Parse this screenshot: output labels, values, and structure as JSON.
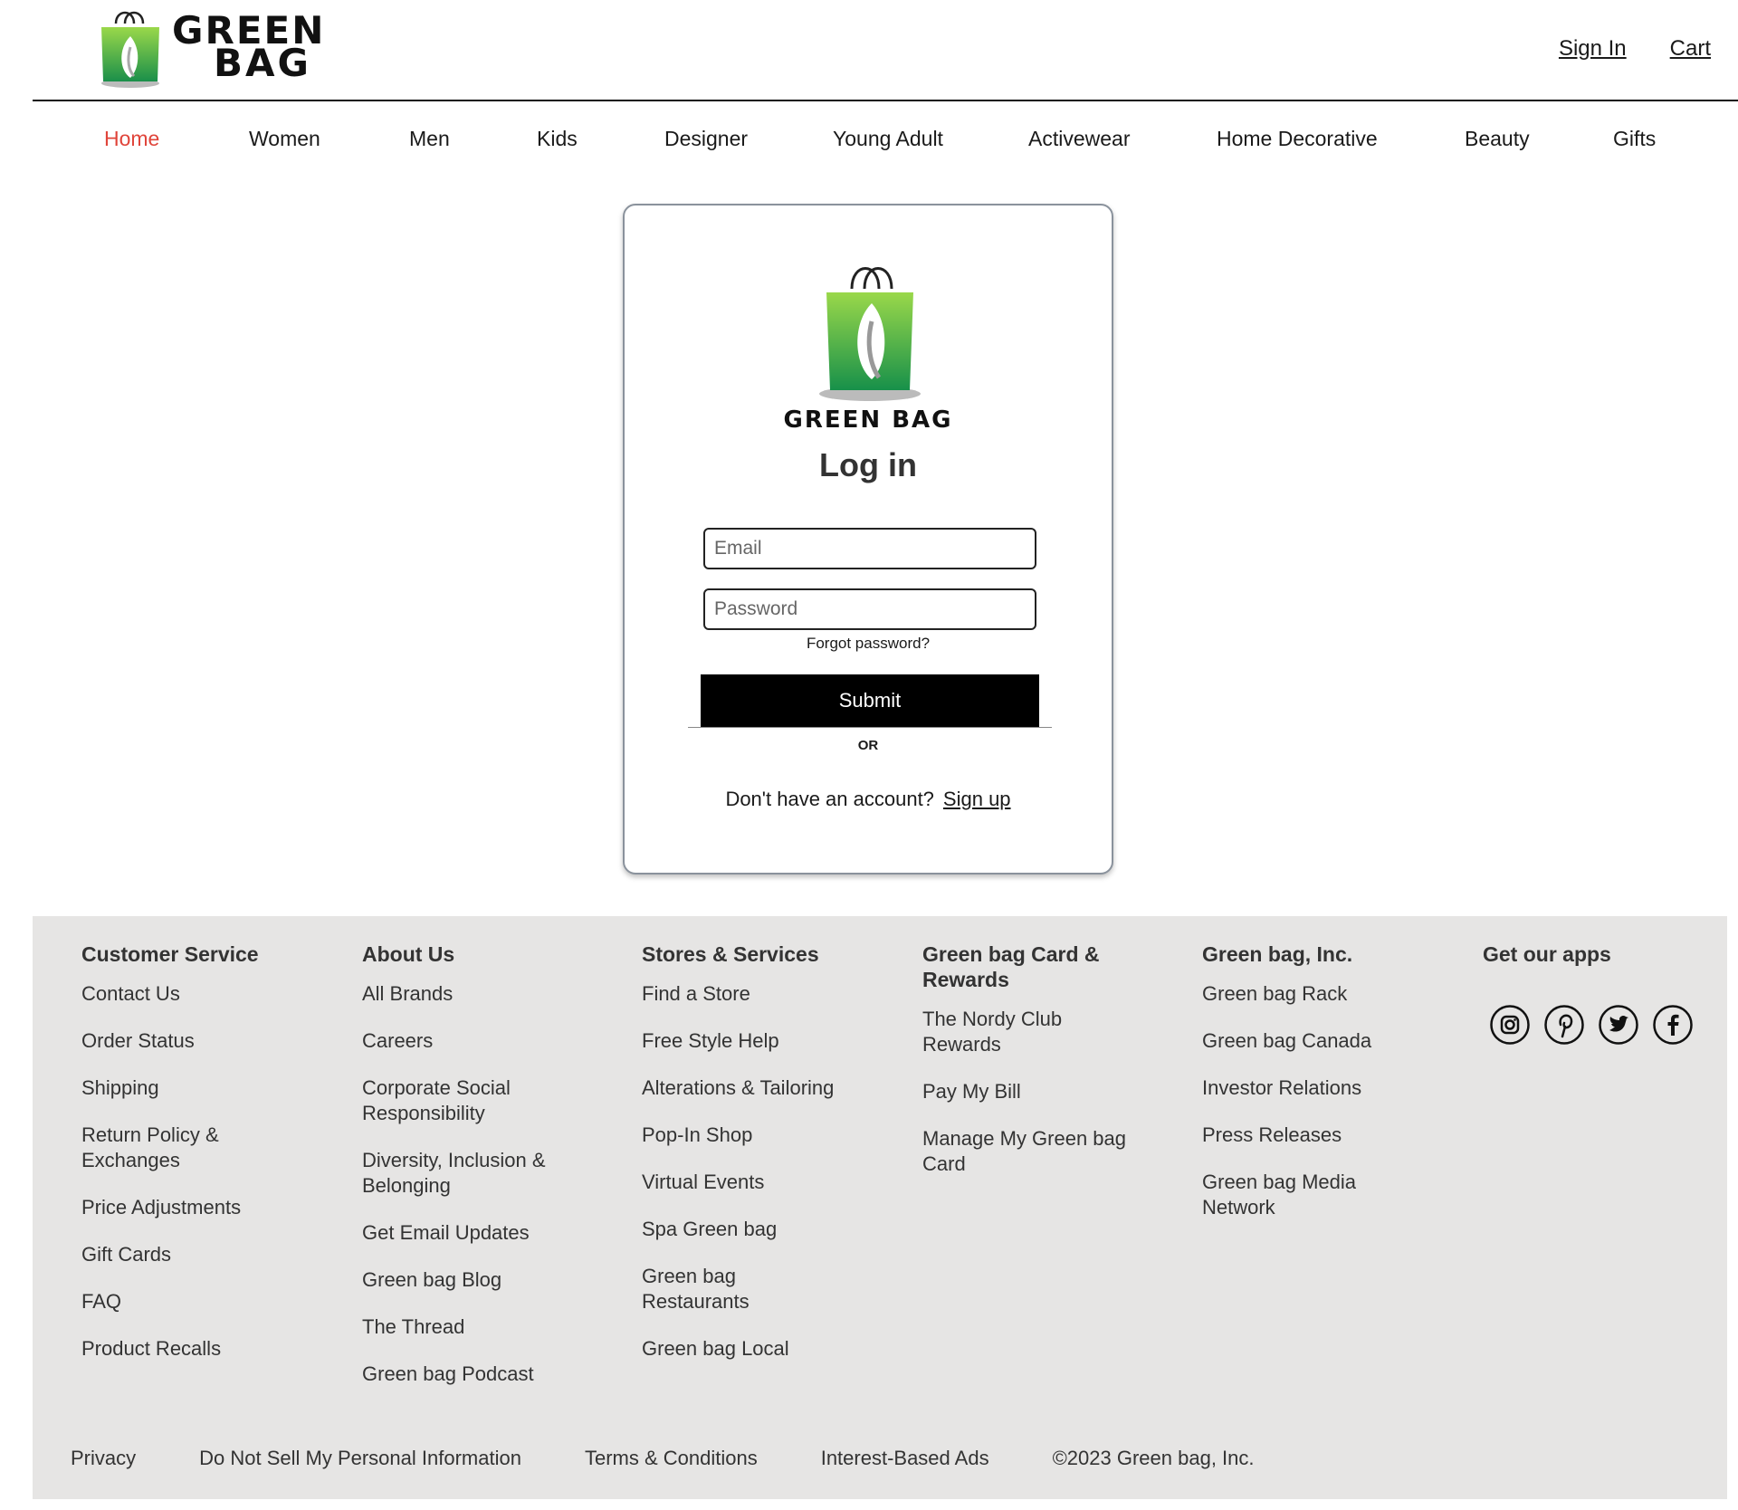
{
  "header": {
    "brand_line1": "GREEN",
    "brand_line2": "BAG",
    "sign_in": "Sign In",
    "cart": "Cart"
  },
  "nav": {
    "items": [
      "Home",
      "Women",
      "Men",
      "Kids",
      "Designer",
      "Young Adult",
      "Activewear",
      "Home Decorative",
      "Beauty",
      "Gifts"
    ],
    "active": "Home",
    "active_color": "#e0443a"
  },
  "login": {
    "brand": "GREEN BAG",
    "title": "Log in",
    "email_placeholder": "Email",
    "password_placeholder": "Password",
    "forgot": "Forgot password?",
    "submit": "Submit",
    "or": "OR",
    "no_account": "Don't have an account?",
    "sign_up": "Sign up"
  },
  "footer": {
    "columns": [
      {
        "title": "Customer Service",
        "links": [
          "Contact Us",
          "Order Status",
          "Shipping",
          "Return Policy & Exchanges",
          "Price Adjustments",
          "Gift Cards",
          "FAQ",
          "Product Recalls"
        ]
      },
      {
        "title": "About Us",
        "links": [
          "All Brands",
          "Careers",
          "Corporate Social Responsibility",
          "Diversity, Inclusion & Belonging",
          "Get Email Updates",
          "Green bag Blog",
          "The Thread",
          "Green bag Podcast"
        ]
      },
      {
        "title": "Stores & Services",
        "links": [
          "Find a Store",
          "Free Style Help",
          "Alterations & Tailoring",
          "Pop-In Shop",
          "Virtual Events",
          "Spa Green bag",
          "Green bag Restaurants",
          "Green bag Local"
        ]
      },
      {
        "title": "Green bag Card & Rewards",
        "links": [
          "The Nordy Club Rewards",
          "Pay My Bill",
          "Manage My Green bag Card"
        ]
      },
      {
        "title": "Green bag, Inc.",
        "links": [
          "Green bag Rack",
          "Green bag Canada",
          "Investor Relations",
          "Press Releases",
          "Green bag Media Network"
        ]
      },
      {
        "title": "Get our apps",
        "links": []
      }
    ],
    "apps": [
      "instagram-icon",
      "pinterest-icon",
      "twitter-icon",
      "facebook-icon"
    ],
    "legal": [
      "Privacy",
      "Do Not Sell My Personal Information",
      "Terms & Conditions",
      "Interest-Based Ads",
      "©2023 Green bag, Inc."
    ]
  },
  "colors": {
    "brand_green": "#3aa83f",
    "footer_bg": "#e6e5e4",
    "accent_red": "#e0443a"
  }
}
